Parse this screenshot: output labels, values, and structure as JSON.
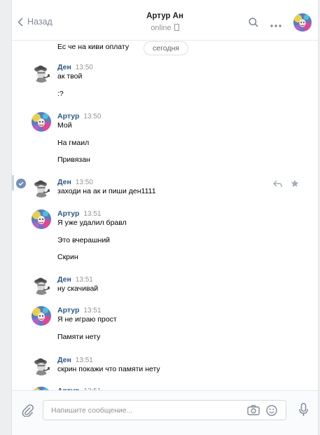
{
  "header": {
    "back_label": "Назад",
    "title": "Артур Ан",
    "status": "online"
  },
  "feed": {
    "first_line": "Ес че на киви оплату",
    "date_separator": "сегодня",
    "messages": [
      {
        "author": "Ден",
        "time": "13:50",
        "lines": [
          "ак твой",
          ":?"
        ]
      },
      {
        "author": "Артур",
        "time": "13:50",
        "lines": [
          "Мой",
          "На гмаил",
          "Привязан"
        ]
      },
      {
        "author": "Ден",
        "time": "13:50",
        "lines": [
          "заходи на ак и пиши ден1111"
        ]
      },
      {
        "author": "Артур",
        "time": "13:51",
        "lines": [
          "Я уже удалил бравл",
          "Это вчерашний",
          "Скрин"
        ]
      },
      {
        "author": "Ден",
        "time": "13:51",
        "lines": [
          "ну скачивай"
        ]
      },
      {
        "author": "Артур",
        "time": "13:51",
        "lines": [
          "Я не играю прост",
          "Памяти нету"
        ]
      },
      {
        "author": "Ден",
        "time": "13:51",
        "lines": [
          "скрин покажи что памяти нету"
        ]
      },
      {
        "author": "Артур",
        "time": "13:51",
        "lines": []
      }
    ]
  },
  "composer": {
    "placeholder": "Напишите сообщение..."
  },
  "icons": {
    "back": "chevron-left-icon",
    "search": "search-icon",
    "more": "more-dots-icon",
    "attach": "paperclip-icon",
    "camera": "camera-icon",
    "emoji": "smile-icon",
    "mic": "microphone-icon",
    "reply": "reply-icon",
    "star": "star-icon",
    "read": "check-circle-icon"
  },
  "colors": {
    "link": "#2a5885",
    "muted": "#939393",
    "icon": "#828a99",
    "selected_check": "#7390b6"
  }
}
